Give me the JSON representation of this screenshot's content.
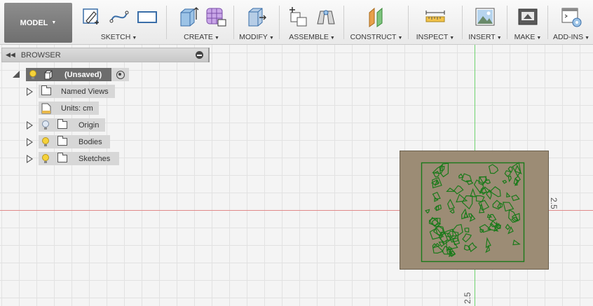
{
  "toolbar": {
    "workspace": "MODEL",
    "groups": [
      {
        "id": "sketch",
        "label": "SKETCH"
      },
      {
        "id": "create",
        "label": "CREATE"
      },
      {
        "id": "modify",
        "label": "MODIFY"
      },
      {
        "id": "assemble",
        "label": "ASSEMBLE"
      },
      {
        "id": "construct",
        "label": "CONSTRUCT"
      },
      {
        "id": "inspect",
        "label": "INSPECT"
      },
      {
        "id": "insert",
        "label": "INSERT"
      },
      {
        "id": "make",
        "label": "MAKE"
      },
      {
        "id": "addins",
        "label": "ADD-INS"
      }
    ]
  },
  "browser": {
    "title": "BROWSER",
    "root": "(Unsaved)",
    "items": [
      {
        "label": "Named Views"
      },
      {
        "label": "Units: cm"
      },
      {
        "label": "Origin"
      },
      {
        "label": "Bodies"
      },
      {
        "label": "Sketches"
      }
    ]
  },
  "viewport": {
    "dim_vertical": "2.5",
    "dim_horizontal": "2.5"
  },
  "colors": {
    "accent_body": "#9c8c75",
    "sketch_profile": "#1a7a1a",
    "axis_green": "#6fd36f",
    "axis_red": "#e08a8a"
  }
}
